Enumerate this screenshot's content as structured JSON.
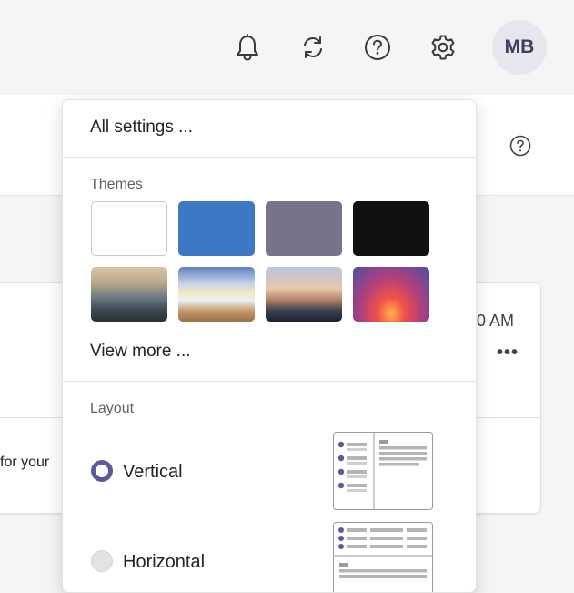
{
  "header": {
    "avatar_initials": "MB",
    "icons": [
      "bell-icon",
      "sync-icon",
      "help-icon",
      "gear-icon"
    ]
  },
  "background": {
    "time_text": "0 AM",
    "more_glyph": "•••",
    "snippet_text": "for your"
  },
  "settings_menu": {
    "all_settings_label": "All settings ...",
    "themes_heading": "Themes",
    "themes": [
      {
        "name": "white-theme",
        "color": "#ffffff"
      },
      {
        "name": "blue-theme",
        "color": "#3d78c4"
      },
      {
        "name": "gray-theme",
        "color": "#767488"
      },
      {
        "name": "black-theme",
        "color": "#111111"
      },
      {
        "name": "mountains-theme",
        "color": "#8a7a5c"
      },
      {
        "name": "beach-theme",
        "color": "#c9b48a"
      },
      {
        "name": "city-theme",
        "color": "#a58a7a"
      },
      {
        "name": "sunset-theme",
        "color": "#8a4a7a"
      }
    ],
    "view_more_label": "View more ...",
    "layout_heading": "Layout",
    "layout_options": [
      {
        "label": "Vertical",
        "selected": true
      },
      {
        "label": "Horizontal",
        "selected": false
      }
    ]
  },
  "colors": {
    "accent": "#5b5b9a",
    "avatar_bg": "#e6e6ee",
    "avatar_text": "#3f3d5c"
  }
}
